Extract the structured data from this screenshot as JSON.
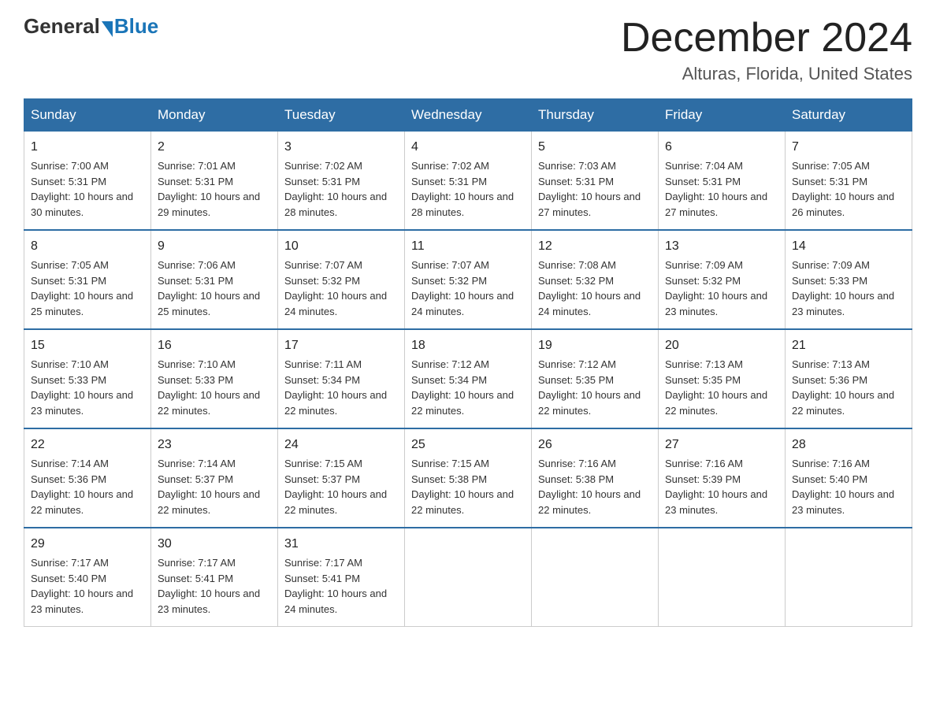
{
  "logo": {
    "general": "General",
    "blue": "Blue"
  },
  "title": {
    "month": "December 2024",
    "location": "Alturas, Florida, United States"
  },
  "headers": [
    "Sunday",
    "Monday",
    "Tuesday",
    "Wednesday",
    "Thursday",
    "Friday",
    "Saturday"
  ],
  "weeks": [
    [
      {
        "day": "1",
        "sunrise": "7:00 AM",
        "sunset": "5:31 PM",
        "daylight": "10 hours and 30 minutes."
      },
      {
        "day": "2",
        "sunrise": "7:01 AM",
        "sunset": "5:31 PM",
        "daylight": "10 hours and 29 minutes."
      },
      {
        "day": "3",
        "sunrise": "7:02 AM",
        "sunset": "5:31 PM",
        "daylight": "10 hours and 28 minutes."
      },
      {
        "day": "4",
        "sunrise": "7:02 AM",
        "sunset": "5:31 PM",
        "daylight": "10 hours and 28 minutes."
      },
      {
        "day": "5",
        "sunrise": "7:03 AM",
        "sunset": "5:31 PM",
        "daylight": "10 hours and 27 minutes."
      },
      {
        "day": "6",
        "sunrise": "7:04 AM",
        "sunset": "5:31 PM",
        "daylight": "10 hours and 27 minutes."
      },
      {
        "day": "7",
        "sunrise": "7:05 AM",
        "sunset": "5:31 PM",
        "daylight": "10 hours and 26 minutes."
      }
    ],
    [
      {
        "day": "8",
        "sunrise": "7:05 AM",
        "sunset": "5:31 PM",
        "daylight": "10 hours and 25 minutes."
      },
      {
        "day": "9",
        "sunrise": "7:06 AM",
        "sunset": "5:31 PM",
        "daylight": "10 hours and 25 minutes."
      },
      {
        "day": "10",
        "sunrise": "7:07 AM",
        "sunset": "5:32 PM",
        "daylight": "10 hours and 24 minutes."
      },
      {
        "day": "11",
        "sunrise": "7:07 AM",
        "sunset": "5:32 PM",
        "daylight": "10 hours and 24 minutes."
      },
      {
        "day": "12",
        "sunrise": "7:08 AM",
        "sunset": "5:32 PM",
        "daylight": "10 hours and 24 minutes."
      },
      {
        "day": "13",
        "sunrise": "7:09 AM",
        "sunset": "5:32 PM",
        "daylight": "10 hours and 23 minutes."
      },
      {
        "day": "14",
        "sunrise": "7:09 AM",
        "sunset": "5:33 PM",
        "daylight": "10 hours and 23 minutes."
      }
    ],
    [
      {
        "day": "15",
        "sunrise": "7:10 AM",
        "sunset": "5:33 PM",
        "daylight": "10 hours and 23 minutes."
      },
      {
        "day": "16",
        "sunrise": "7:10 AM",
        "sunset": "5:33 PM",
        "daylight": "10 hours and 22 minutes."
      },
      {
        "day": "17",
        "sunrise": "7:11 AM",
        "sunset": "5:34 PM",
        "daylight": "10 hours and 22 minutes."
      },
      {
        "day": "18",
        "sunrise": "7:12 AM",
        "sunset": "5:34 PM",
        "daylight": "10 hours and 22 minutes."
      },
      {
        "day": "19",
        "sunrise": "7:12 AM",
        "sunset": "5:35 PM",
        "daylight": "10 hours and 22 minutes."
      },
      {
        "day": "20",
        "sunrise": "7:13 AM",
        "sunset": "5:35 PM",
        "daylight": "10 hours and 22 minutes."
      },
      {
        "day": "21",
        "sunrise": "7:13 AM",
        "sunset": "5:36 PM",
        "daylight": "10 hours and 22 minutes."
      }
    ],
    [
      {
        "day": "22",
        "sunrise": "7:14 AM",
        "sunset": "5:36 PM",
        "daylight": "10 hours and 22 minutes."
      },
      {
        "day": "23",
        "sunrise": "7:14 AM",
        "sunset": "5:37 PM",
        "daylight": "10 hours and 22 minutes."
      },
      {
        "day": "24",
        "sunrise": "7:15 AM",
        "sunset": "5:37 PM",
        "daylight": "10 hours and 22 minutes."
      },
      {
        "day": "25",
        "sunrise": "7:15 AM",
        "sunset": "5:38 PM",
        "daylight": "10 hours and 22 minutes."
      },
      {
        "day": "26",
        "sunrise": "7:16 AM",
        "sunset": "5:38 PM",
        "daylight": "10 hours and 22 minutes."
      },
      {
        "day": "27",
        "sunrise": "7:16 AM",
        "sunset": "5:39 PM",
        "daylight": "10 hours and 23 minutes."
      },
      {
        "day": "28",
        "sunrise": "7:16 AM",
        "sunset": "5:40 PM",
        "daylight": "10 hours and 23 minutes."
      }
    ],
    [
      {
        "day": "29",
        "sunrise": "7:17 AM",
        "sunset": "5:40 PM",
        "daylight": "10 hours and 23 minutes."
      },
      {
        "day": "30",
        "sunrise": "7:17 AM",
        "sunset": "5:41 PM",
        "daylight": "10 hours and 23 minutes."
      },
      {
        "day": "31",
        "sunrise": "7:17 AM",
        "sunset": "5:41 PM",
        "daylight": "10 hours and 24 minutes."
      },
      null,
      null,
      null,
      null
    ]
  ]
}
